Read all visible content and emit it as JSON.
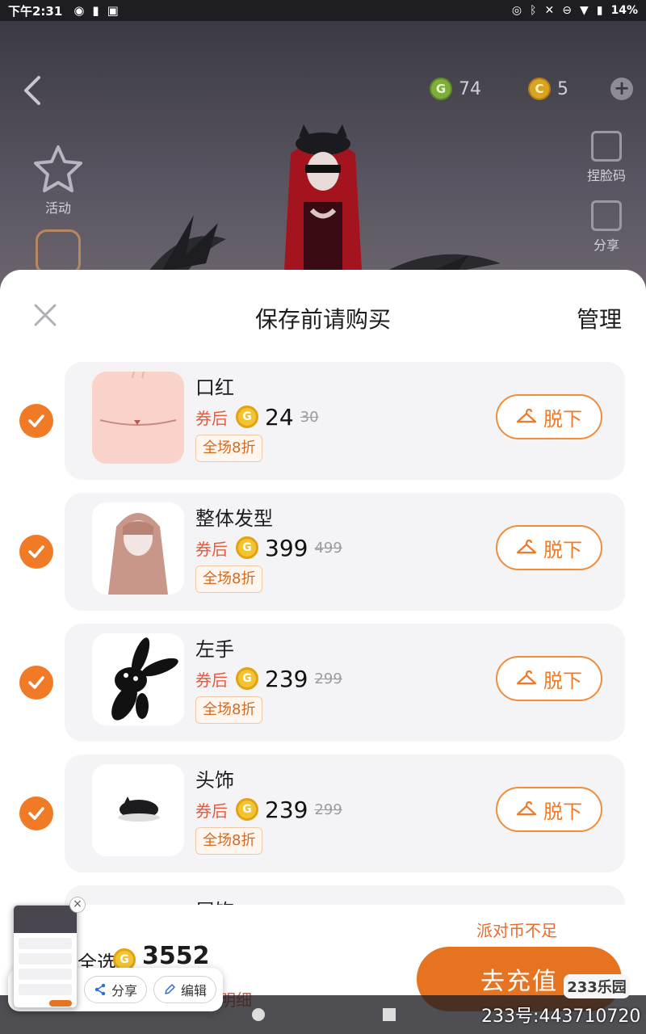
{
  "status_bar": {
    "time": "下午2:31",
    "battery": "14%"
  },
  "scene": {
    "green_currency": "74",
    "gold_currency": "5",
    "left_menu": [
      "活动"
    ],
    "right_menu": [
      "捏脸码",
      "分享"
    ]
  },
  "sheet": {
    "title": "保存前请购买",
    "manage_label": "管理",
    "items": [
      {
        "name": "口红",
        "after_label": "券后",
        "price": "24",
        "original_price": "30",
        "discount": "全场8折",
        "action": "脱下",
        "checked": true
      },
      {
        "name": "整体发型",
        "after_label": "券后",
        "price": "399",
        "original_price": "499",
        "discount": "全场8折",
        "action": "脱下",
        "checked": true
      },
      {
        "name": "左手",
        "after_label": "券后",
        "price": "239",
        "original_price": "299",
        "discount": "全场8折",
        "action": "脱下",
        "checked": true
      },
      {
        "name": "头饰",
        "after_label": "券后",
        "price": "239",
        "original_price": "299",
        "discount": "全场8折",
        "action": "脱下",
        "checked": true
      },
      {
        "name": "尾饰"
      }
    ]
  },
  "bottom_bar": {
    "insufficient": "派对币不足",
    "select_all": "全选",
    "total": "3552",
    "detail": "明细",
    "recharge": "去充值"
  },
  "overlay": {
    "share": "分享",
    "edit": "编辑"
  },
  "watermark": {
    "logo": "233乐园",
    "id": "233号:443710720"
  },
  "colors": {
    "accent": "#f07a26",
    "recharge": "#e67320",
    "coin": "#f4c430"
  }
}
